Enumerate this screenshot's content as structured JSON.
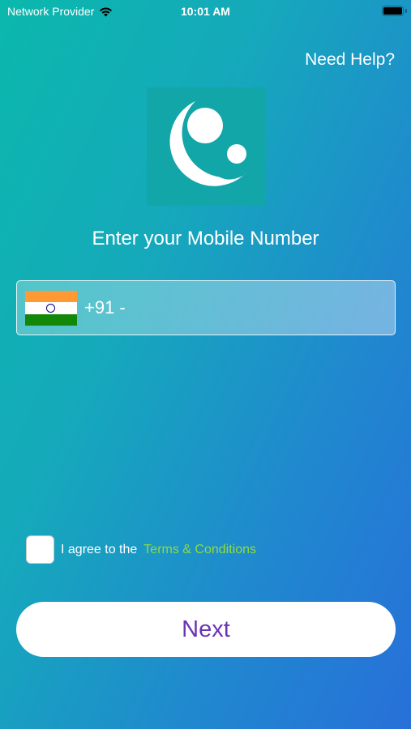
{
  "status_bar": {
    "carrier": "Network Provider",
    "time": "10:01 AM",
    "wifi_icon": "wifi-icon",
    "battery_icon": "battery-icon"
  },
  "header": {
    "help_label": "Need Help?"
  },
  "logo": {
    "icon": "mother-child-logo-icon",
    "background_color": "#12a6a9"
  },
  "main": {
    "title": "Enter your Mobile Number",
    "country_flag_icon": "india-flag-icon",
    "country_code": "+91 -",
    "phone_value": "",
    "phone_placeholder": ""
  },
  "agreement": {
    "checked": false,
    "text": "I agree to the",
    "terms_label": "Terms & Conditions",
    "terms_color": "#8fdc3a"
  },
  "actions": {
    "next_label": "Next",
    "next_color": "#6a33b5"
  },
  "colors": {
    "gradient_start": "#0bb8ac",
    "gradient_end": "#2770d9"
  }
}
